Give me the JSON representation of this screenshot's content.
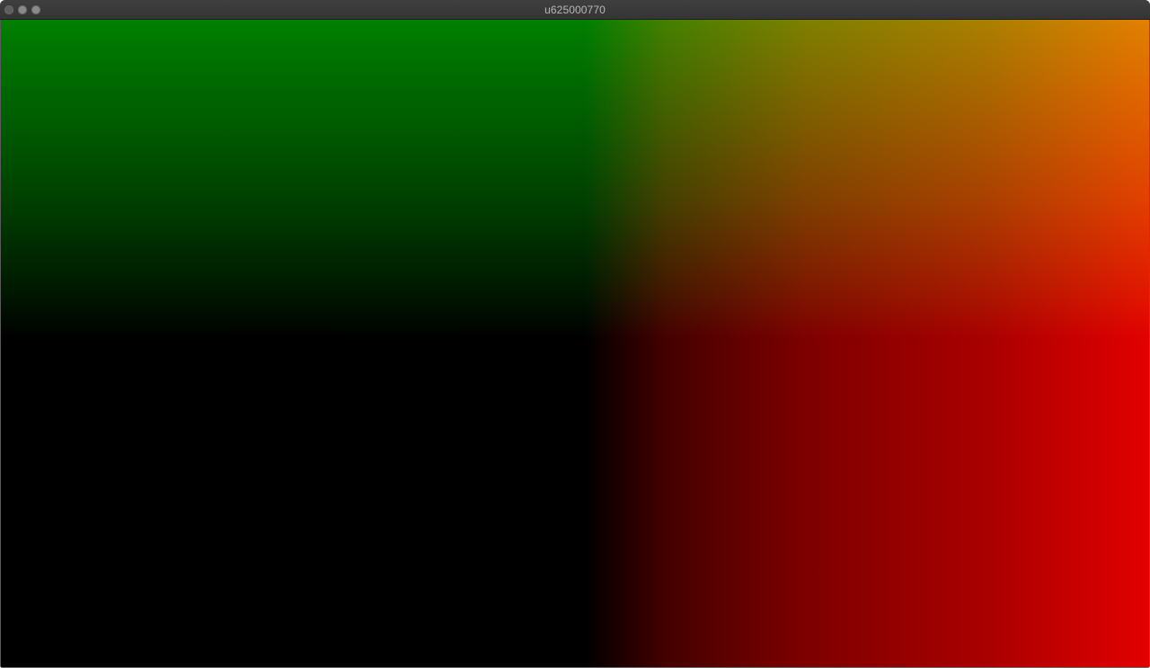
{
  "window": {
    "title": "u625000770"
  },
  "canvas": {
    "colors": {
      "top_left": "#008000",
      "top_right": "#e28000",
      "bottom_left": "#000000",
      "bottom_right": "#e20000"
    }
  }
}
